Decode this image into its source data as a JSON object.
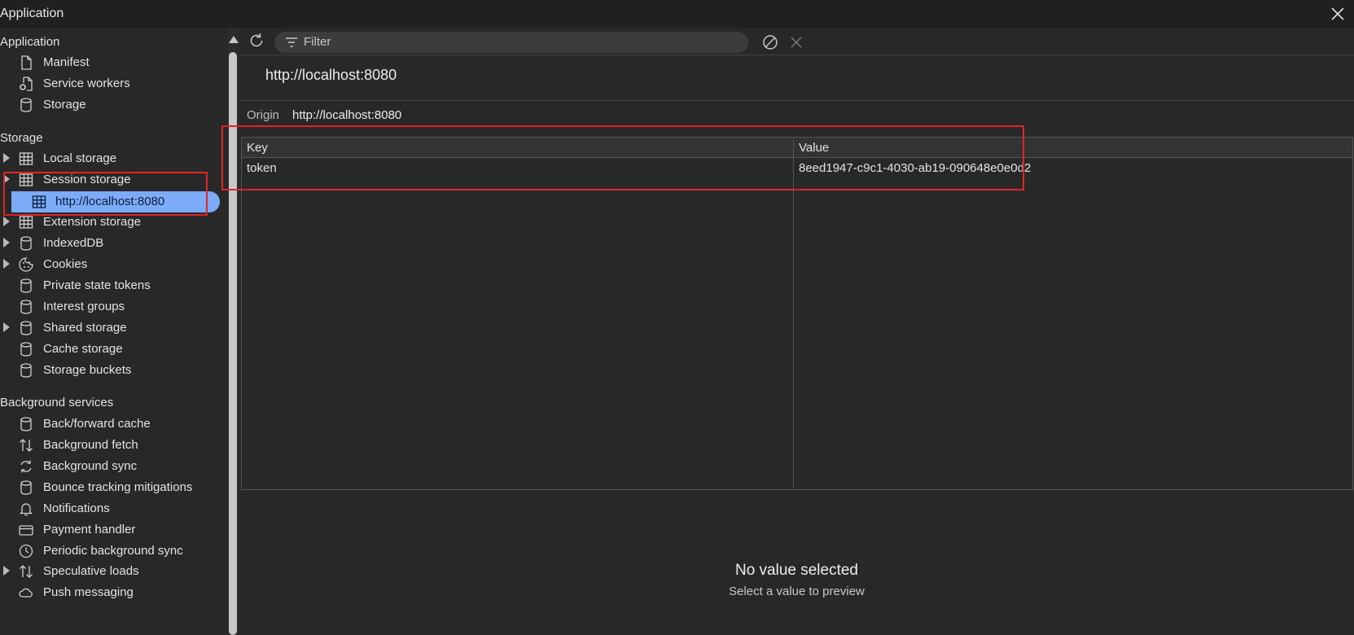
{
  "window": {
    "title": "Application"
  },
  "sidebar": {
    "sections": [
      {
        "label": "Application"
      },
      {
        "label": "Storage"
      },
      {
        "label": "Background services"
      }
    ],
    "application_items": [
      {
        "label": "Manifest",
        "icon": "document-icon"
      },
      {
        "label": "Service workers",
        "icon": "gear-document-icon"
      },
      {
        "label": "Storage",
        "icon": "database-icon"
      }
    ],
    "storage_items": [
      {
        "label": "Local storage",
        "icon": "table-icon",
        "expandable": true
      },
      {
        "label": "Session storage",
        "icon": "table-icon",
        "expandable": true
      },
      {
        "label": "http://localhost:8080",
        "icon": "table-icon",
        "selected": true
      },
      {
        "label": "Extension storage",
        "icon": "table-icon",
        "expandable": true
      },
      {
        "label": "IndexedDB",
        "icon": "database-icon",
        "expandable": true
      },
      {
        "label": "Cookies",
        "icon": "cookie-icon",
        "expandable": true
      },
      {
        "label": "Private state tokens",
        "icon": "database-icon"
      },
      {
        "label": "Interest groups",
        "icon": "database-icon"
      },
      {
        "label": "Shared storage",
        "icon": "database-icon",
        "expandable": true
      },
      {
        "label": "Cache storage",
        "icon": "database-icon"
      },
      {
        "label": "Storage buckets",
        "icon": "database-icon"
      }
    ],
    "background_items": [
      {
        "label": "Back/forward cache",
        "icon": "database-icon"
      },
      {
        "label": "Background fetch",
        "icon": "up-down-arrows-icon"
      },
      {
        "label": "Background sync",
        "icon": "sync-icon"
      },
      {
        "label": "Bounce tracking mitigations",
        "icon": "database-icon"
      },
      {
        "label": "Notifications",
        "icon": "bell-icon"
      },
      {
        "label": "Payment handler",
        "icon": "card-icon"
      },
      {
        "label": "Periodic background sync",
        "icon": "clock-icon"
      },
      {
        "label": "Speculative loads",
        "icon": "up-down-arrows-icon",
        "expandable": true
      },
      {
        "label": "Push messaging",
        "icon": "cloud-icon"
      }
    ]
  },
  "toolbar": {
    "filter_placeholder": "Filter"
  },
  "main": {
    "origin_heading": "http://localhost:8080",
    "origin_label": "Origin",
    "origin_value": "http://localhost:8080",
    "table": {
      "columns": [
        "Key",
        "Value"
      ],
      "rows": [
        {
          "key": "token",
          "value": "8eed1947-c9c1-4030-ab19-090648e0e0d2"
        }
      ]
    },
    "preview": {
      "title": "No value selected",
      "subtitle": "Select a value to preview"
    }
  },
  "colors": {
    "background": "#282828",
    "selected": "#7cacf8",
    "highlight": "#e02424"
  }
}
